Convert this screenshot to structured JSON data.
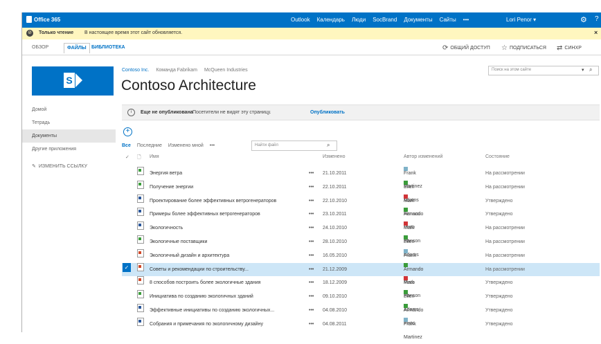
{
  "suitebar": {
    "brand": "Office 365",
    "nav": [
      "Outlook",
      "Календарь",
      "Люди",
      "SocBrand",
      "Документы",
      "Сайты",
      "•••"
    ],
    "user": "Lori Penor ▾",
    "settings_icon": "gear-icon",
    "help_label": "?"
  },
  "status": {
    "title": "Только чтение",
    "text": "В настоящее время этот сайт обновляется.",
    "close": "×"
  },
  "ribbon": {
    "tabs": [
      "ОБЗОР",
      "ФАЙЛЫ",
      "БИБЛИОТЕКА"
    ],
    "share": "ОБЩИЙ ДОСТУП",
    "follow": "ПОДПИСАТЬСЯ",
    "sync": "СИНХР"
  },
  "site": {
    "breadcrumbs": [
      "Contoso Inc.",
      "Команда Fabrikam",
      "McQueen Industries"
    ],
    "title": "Contoso Architecture",
    "search_placeholder": "Поиск на этом сайте"
  },
  "leftnav": {
    "items": [
      "Домой",
      "Тетрадь",
      "Документы",
      "Другие приложения"
    ],
    "active_index": 2,
    "edit_links": "ИЗМЕНИТЬ ССЫЛКУ"
  },
  "notice": {
    "title": "Еще не опубликована",
    "text": "Посетители не видят эту страницу.",
    "link": "Опубликовать"
  },
  "toolbar": {
    "new_icon": "plus-circle-icon",
    "views": [
      "Все",
      "Последние",
      "Изменено мной",
      "•••"
    ],
    "search_placeholder": "Найти файл"
  },
  "grid": {
    "headers": {
      "name": "Имя",
      "modified": "Изменено",
      "modified_by": "Автор изменений",
      "state": "Состояние"
    },
    "rows": [
      {
        "name": "Энергия ветра",
        "modified": "21.10.2011",
        "author": "Frank Martinez",
        "color": "#7fb2c8",
        "state": "На рассмотрении",
        "type": "#3a9c3a",
        "selected": false
      },
      {
        "name": "Получение энергии",
        "modified": "22.10.2011",
        "author": "Ellen Adams",
        "color": "#3a9c3a",
        "state": "На рассмотрении",
        "type": "#3a9c3a",
        "selected": false
      },
      {
        "name": "Проектирование более эффективных ветрогенераторов",
        "modified": "22.10.2010",
        "author": "Mark Hanson",
        "color": "#d13438",
        "state": "Утверждено",
        "type": "#2b579a",
        "selected": false
      },
      {
        "name": "Примеры более эффективных ветрогенераторов",
        "modified": "23.10.2011",
        "author": "Armando Pinto",
        "color": "#3a9c3a",
        "state": "Утверждено",
        "type": "#2b579a",
        "selected": false
      },
      {
        "name": "Экологичность",
        "modified": "24.10.2010",
        "author": "Mark Hanson",
        "color": "#d13438",
        "state": "На рассмотрении",
        "type": "#2b579a",
        "selected": false
      },
      {
        "name": "Экологичные поставщики",
        "modified": "28.10.2010",
        "author": "Ellen Adams",
        "color": "#3a9c3a",
        "state": "На рассмотрении",
        "type": "#3a9c3a",
        "selected": false
      },
      {
        "name": "Экологичный дизайн и архитектура",
        "modified": "16.05.2010",
        "author": "Frank Martinez",
        "color": "#7fb2c8",
        "state": "На рассмотрении",
        "type": "#d24726",
        "selected": false
      },
      {
        "name": "Советы и рекомендации по строительству...",
        "modified": "21.12.2009",
        "author": "Armando Pinto",
        "color": "#3a9c3a",
        "state": "На рассмотрении",
        "type": "#d24726",
        "selected": true
      },
      {
        "name": "8 способов построить более экологичные здания",
        "modified": "18.12.2009",
        "author": "Mark Hanson",
        "color": "#d13438",
        "state": "Утверждено",
        "type": "#d24726",
        "selected": false
      },
      {
        "name": "Инициатива по созданию экологичных зданий",
        "modified": "09.10.2010",
        "author": "Ellen Adams",
        "color": "#3a9c3a",
        "state": "Утверждено",
        "type": "#3a9c3a",
        "selected": false
      },
      {
        "name": "Эффективные инициативы по созданию экологичных...",
        "modified": "04.08.2010",
        "author": "Armando Pinto",
        "color": "#3a9c3a",
        "state": "Утверждено",
        "type": "#2b579a",
        "selected": false
      },
      {
        "name": "Собрания и примечания по экологичному дизайну",
        "modified": "04.08.2011",
        "author": "Frank Martinez",
        "color": "#7fb2c8",
        "state": "Утверждено",
        "type": "#2b579a",
        "selected": false
      }
    ]
  }
}
